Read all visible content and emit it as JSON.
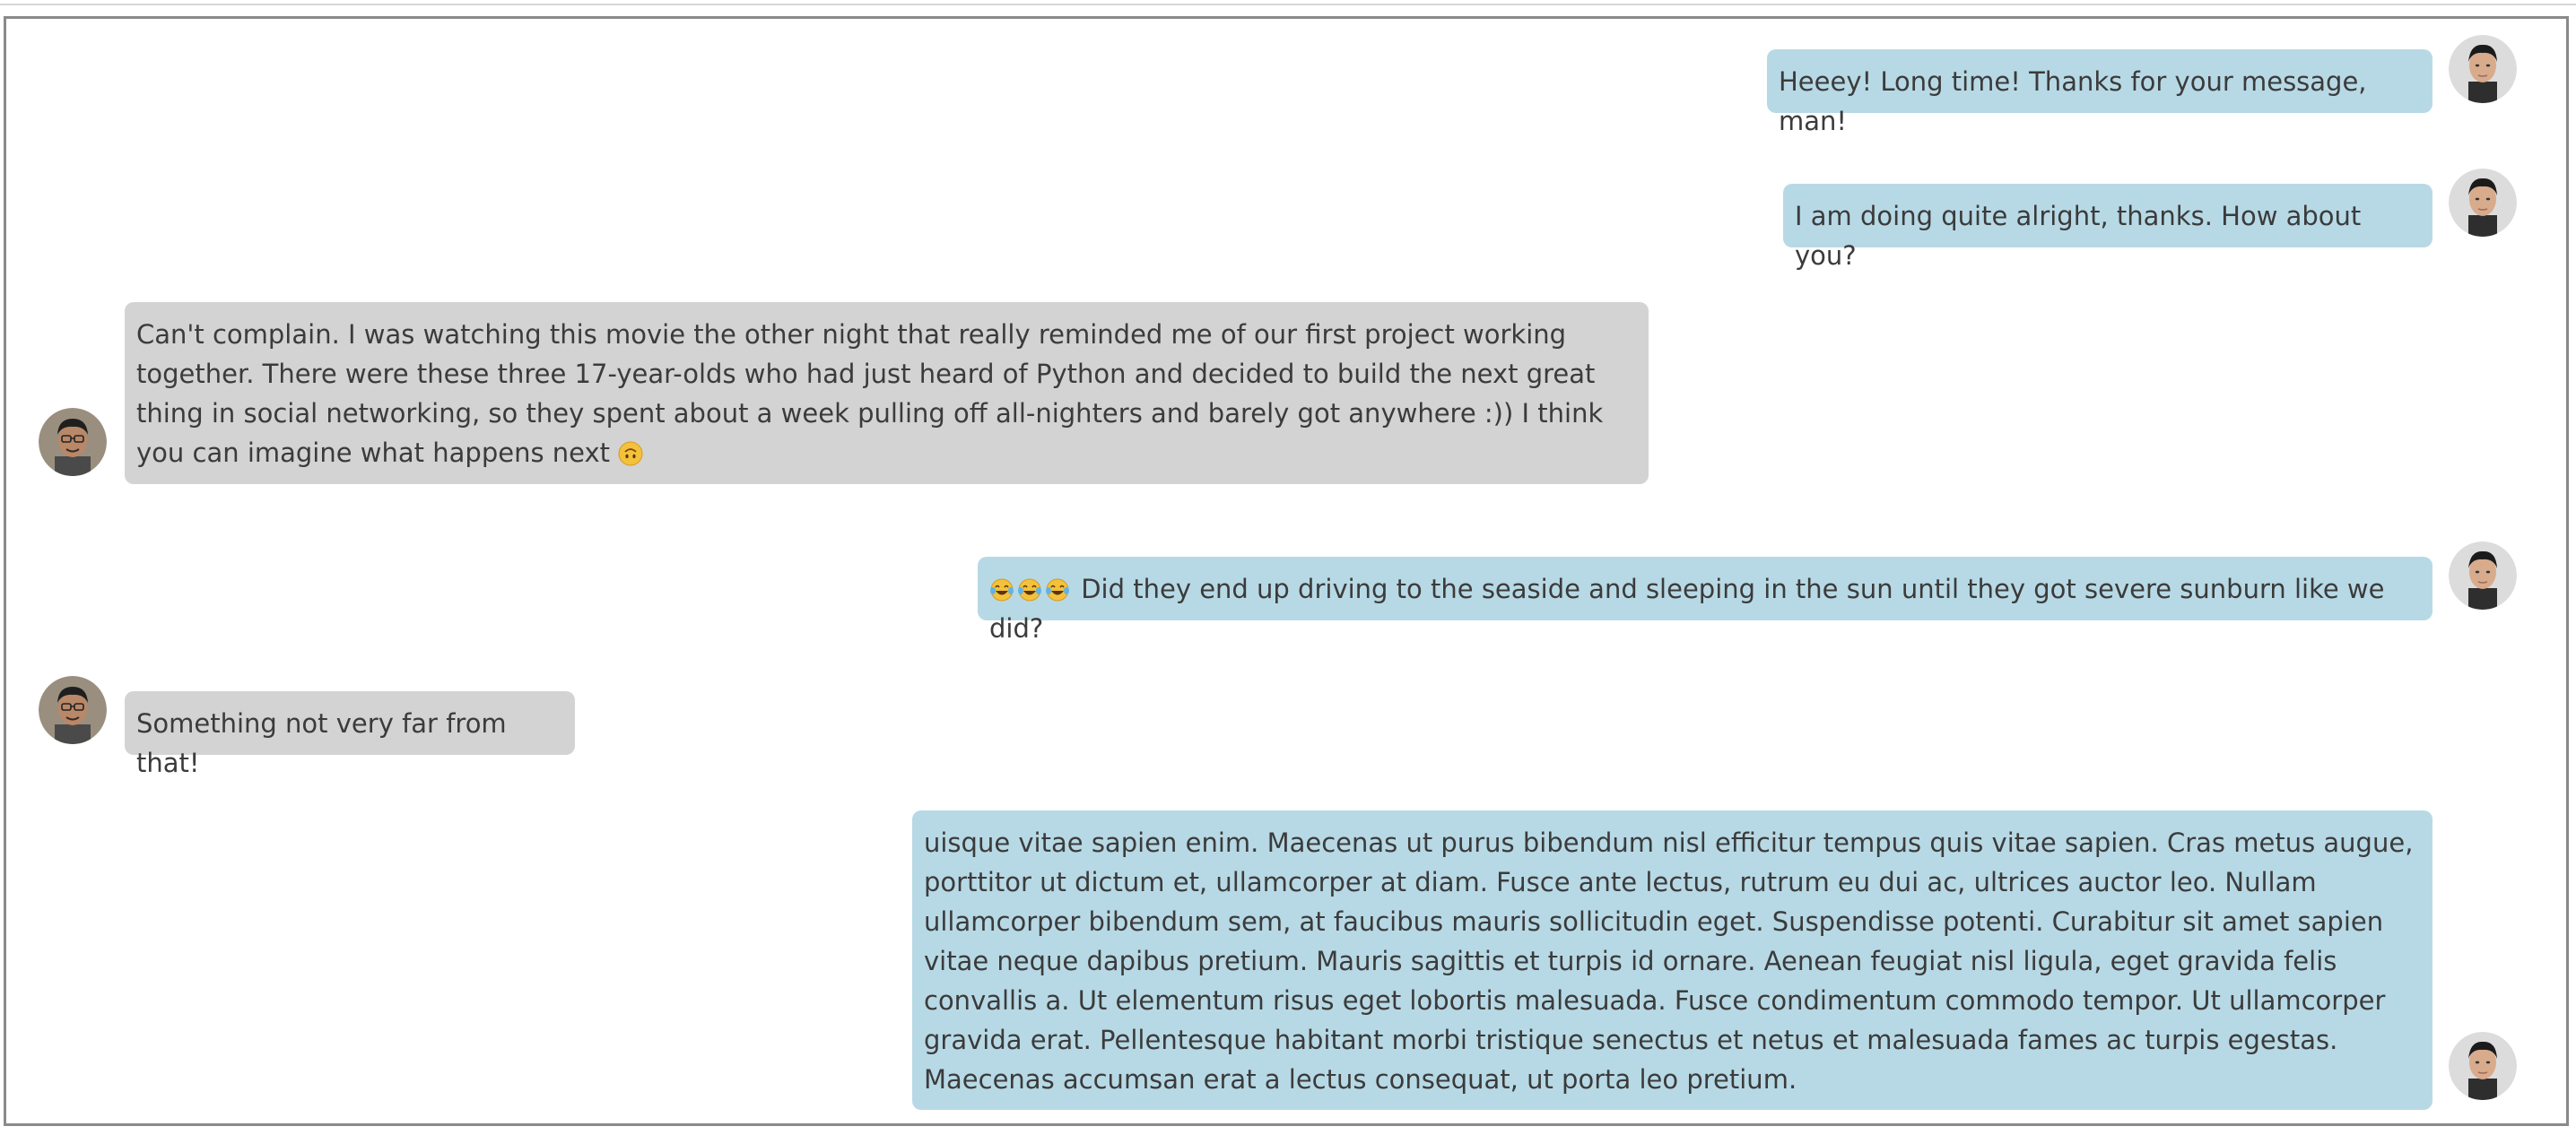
{
  "messages": [
    {
      "sender": "me",
      "text": "Heeey! Long time! Thanks for your message, man!"
    },
    {
      "sender": "me",
      "text": "I am doing quite alright, thanks. How about you?"
    },
    {
      "sender": "friend",
      "text": "Can't complain. I was watching this movie the other night that really reminded me of our first project working together. There were these three 17-year-olds who had just heard of Python and decided to build the next great thing in social networking, so they spent about a week pulling off all-nighters and barely got anywhere :)) I think you can imagine what happens next",
      "emoji_suffix": "upside-down-face-emoji"
    },
    {
      "sender": "me",
      "text": "Did they end up driving to the seaside and sleeping in the sun until they got severe sunburn like we did?",
      "emoji_prefix": [
        "tears-of-joy-emoji",
        "tears-of-joy-emoji",
        "tears-of-joy-emoji"
      ]
    },
    {
      "sender": "friend",
      "text": "Something not very far from that!"
    },
    {
      "sender": "me",
      "text": "uisque vitae sapien enim. Maecenas ut purus bibendum nisl efficitur tempus quis vitae sapien. Cras metus augue, porttitor ut dictum et, ullamcorper at diam. Fusce ante lectus, rutrum eu dui ac, ultrices auctor leo. Nullam ullamcorper bibendum sem, at faucibus mauris sollicitudin eget. Suspendisse potenti. Curabitur sit amet sapien vitae neque dapibus pretium. Mauris sagittis et turpis id ornare. Aenean feugiat nisl ligula, eget gravida felis convallis a. Ut elementum risus eget lobortis malesuada. Fusce condimentum commodo tempor. Ut ullamcorper gravida erat. Pellentesque habitant morbi tristique senectus et netus et malesuada fames ac turpis egestas. Maecenas accumsan erat a lectus consequat, ut porta leo pretium."
    }
  ],
  "colors": {
    "sent_bubble": "#b7d9e5",
    "received_bubble": "#d3d3d3",
    "text": "#3b3b3b",
    "frame_border": "#8a8a8a"
  },
  "icons": {
    "me_avatar": "user-avatar-icon",
    "friend_avatar": "contact-avatar-icon"
  }
}
